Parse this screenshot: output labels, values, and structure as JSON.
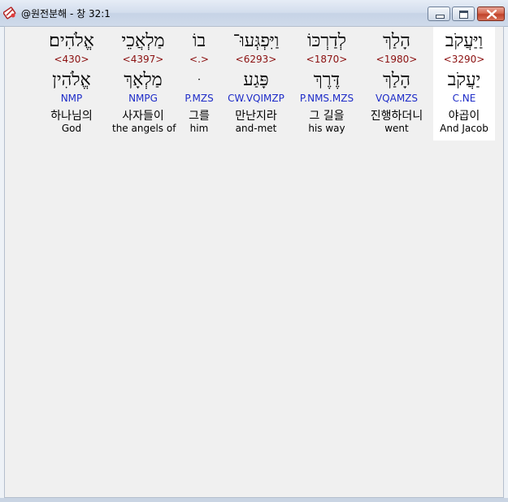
{
  "window": {
    "title": "@원전분해 - 창 32:1",
    "minimize_icon": "minimize-icon",
    "maximize_icon": "maximize-icon",
    "close_icon": "close-icon",
    "app_icon": "app-logo-icon"
  },
  "colors": {
    "strong_number": "#8b1010",
    "morphology": "#1e2cc8",
    "selected_bg": "#ffffff"
  },
  "words": [
    {
      "surface": "וַיַּעֲקֹב",
      "strong": "<3290>",
      "lemma": "יַעֲקֹב",
      "morph": "C.NE",
      "korean": "야곱이",
      "english": "And Jacob",
      "selected": true
    },
    {
      "surface": "הָלַךְ",
      "strong": "<1980>",
      "lemma": "הָלַךְ",
      "morph": "VQAMZS",
      "korean": "진행하더니",
      "english": "went",
      "selected": false
    },
    {
      "surface": "לְדַרְכּוֹ",
      "strong": "<1870>",
      "lemma": "דֶּרֶךְ",
      "morph": "P.NMS.MZS",
      "korean": "그 길을",
      "english": "his way",
      "selected": false
    },
    {
      "surface": "וַיִּפְגְּעוּ־",
      "strong": "<6293>",
      "lemma": "פָּגַע",
      "morph": "CW.VQIMZP",
      "korean": "만난지라",
      "english": "and-met",
      "selected": false
    },
    {
      "surface": "בוֹ",
      "strong": "<.>",
      "lemma": "ּ",
      "morph": "P.MZS",
      "korean": "그를",
      "english": "him",
      "selected": false
    },
    {
      "surface": "מַלְאֲכֵי",
      "strong": "<4397>",
      "lemma": "מַלְאָךְ",
      "morph": "NMPG",
      "korean": "사자들이",
      "english": "the angels of",
      "selected": false
    },
    {
      "surface": "אֱלֹהִים׃",
      "strong": "<430>",
      "lemma": "אֱלֹהִין",
      "morph": "NMP",
      "korean": "하나님의",
      "english": "God",
      "selected": false
    }
  ]
}
